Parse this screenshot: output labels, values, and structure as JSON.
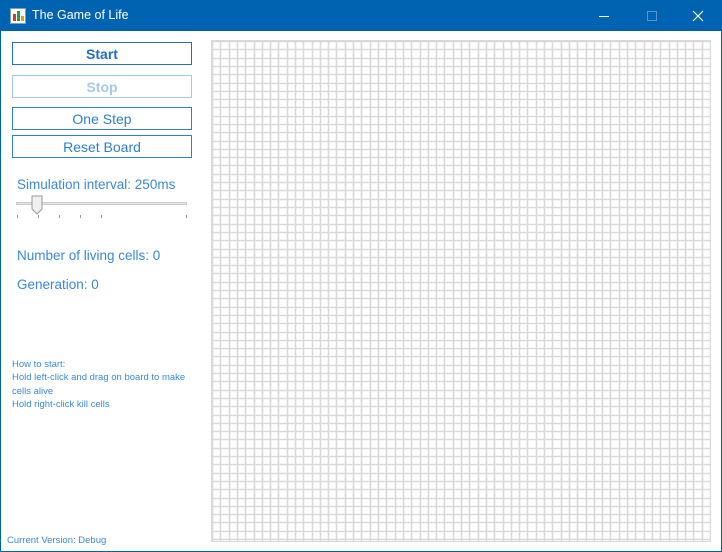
{
  "window": {
    "title": "The Game of Life",
    "controls": [
      "minimize",
      "maximize",
      "close"
    ]
  },
  "buttons": {
    "start": "Start",
    "stop": "Stop",
    "one_step": "One Step",
    "reset": "Reset Board"
  },
  "simulation": {
    "interval_label": "Simulation interval: 250ms",
    "slider_level": 0.12
  },
  "stats": {
    "living_cells": "Number of living cells: 0",
    "generation": "Generation: 0"
  },
  "help": {
    "line1": "How to start:",
    "line2": "Hold left-click and drag on board to make cells alive",
    "line3": "Hold right-click kill cells"
  },
  "footer": {
    "version": "Current Version: Debug"
  },
  "colors": {
    "titlebar": "#0063b1",
    "accent": "#2f7fd0",
    "disabled": "#a8c8ea",
    "grid": "#d9d9d9"
  }
}
